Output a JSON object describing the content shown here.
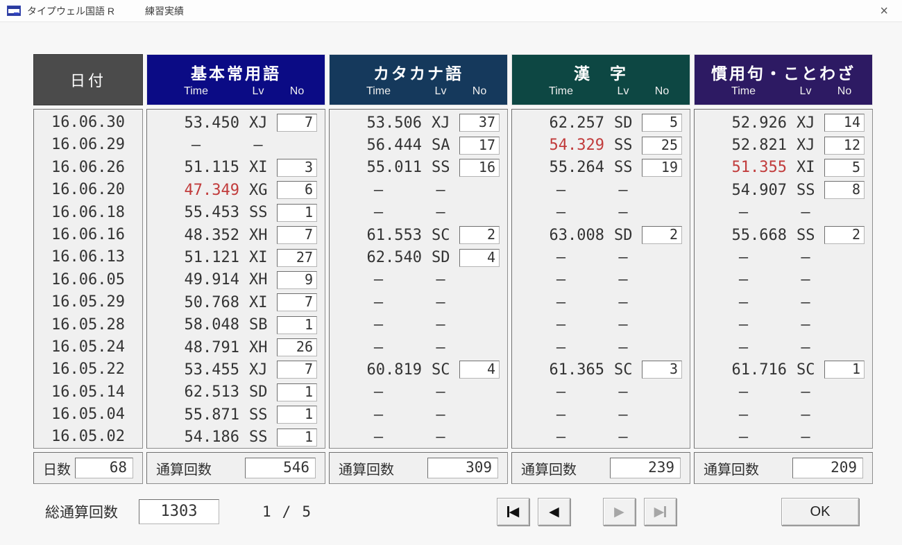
{
  "window": {
    "title": "タイプウェル国語 R",
    "subtitle": "練習実績",
    "close_glyph": "×"
  },
  "colors": {
    "record_time": "#c13b3b",
    "date_header_bg": "#4b4b4b",
    "category_header_bgs": [
      "#0b0b85",
      "#15395c",
      "#0d4743",
      "#2d1a63"
    ]
  },
  "table": {
    "date_header": "日付",
    "sub_headers": {
      "time": "Time",
      "lv": "Lv",
      "no": "No"
    },
    "empty_glyph": "–",
    "categories": [
      {
        "label": "基本常用語"
      },
      {
        "label": "カタカナ語"
      },
      {
        "label": "漢　字"
      },
      {
        "label": "慣用句・ことわざ"
      }
    ],
    "rows": [
      {
        "date": "16.06.30",
        "cells": [
          {
            "time": "53.450",
            "lv": "XJ",
            "no": "7",
            "record": false
          },
          {
            "time": "53.506",
            "lv": "XJ",
            "no": "37",
            "record": false
          },
          {
            "time": "62.257",
            "lv": "SD",
            "no": "5",
            "record": false
          },
          {
            "time": "52.926",
            "lv": "XJ",
            "no": "14",
            "record": false
          }
        ]
      },
      {
        "date": "16.06.29",
        "cells": [
          {
            "time": "–",
            "lv": "–",
            "no": null,
            "record": false
          },
          {
            "time": "56.444",
            "lv": "SA",
            "no": "17",
            "record": false
          },
          {
            "time": "54.329",
            "lv": "SS",
            "no": "25",
            "record": true
          },
          {
            "time": "52.821",
            "lv": "XJ",
            "no": "12",
            "record": false
          }
        ]
      },
      {
        "date": "16.06.26",
        "cells": [
          {
            "time": "51.115",
            "lv": "XI",
            "no": "3",
            "record": false
          },
          {
            "time": "55.011",
            "lv": "SS",
            "no": "16",
            "record": false
          },
          {
            "time": "55.264",
            "lv": "SS",
            "no": "19",
            "record": false
          },
          {
            "time": "51.355",
            "lv": "XI",
            "no": "5",
            "record": true
          }
        ]
      },
      {
        "date": "16.06.20",
        "cells": [
          {
            "time": "47.349",
            "lv": "XG",
            "no": "6",
            "record": true
          },
          {
            "time": "–",
            "lv": "–",
            "no": null,
            "record": false
          },
          {
            "time": "–",
            "lv": "–",
            "no": null,
            "record": false
          },
          {
            "time": "54.907",
            "lv": "SS",
            "no": "8",
            "record": false
          }
        ]
      },
      {
        "date": "16.06.18",
        "cells": [
          {
            "time": "55.453",
            "lv": "SS",
            "no": "1",
            "record": false
          },
          {
            "time": "–",
            "lv": "–",
            "no": null,
            "record": false
          },
          {
            "time": "–",
            "lv": "–",
            "no": null,
            "record": false
          },
          {
            "time": "–",
            "lv": "–",
            "no": null,
            "record": false
          }
        ]
      },
      {
        "date": "16.06.16",
        "cells": [
          {
            "time": "48.352",
            "lv": "XH",
            "no": "7",
            "record": false
          },
          {
            "time": "61.553",
            "lv": "SC",
            "no": "2",
            "record": false
          },
          {
            "time": "63.008",
            "lv": "SD",
            "no": "2",
            "record": false
          },
          {
            "time": "55.668",
            "lv": "SS",
            "no": "2",
            "record": false
          }
        ]
      },
      {
        "date": "16.06.13",
        "cells": [
          {
            "time": "51.121",
            "lv": "XI",
            "no": "27",
            "record": false
          },
          {
            "time": "62.540",
            "lv": "SD",
            "no": "4",
            "record": false
          },
          {
            "time": "–",
            "lv": "–",
            "no": null,
            "record": false
          },
          {
            "time": "–",
            "lv": "–",
            "no": null,
            "record": false
          }
        ]
      },
      {
        "date": "16.06.05",
        "cells": [
          {
            "time": "49.914",
            "lv": "XH",
            "no": "9",
            "record": false
          },
          {
            "time": "–",
            "lv": "–",
            "no": null,
            "record": false
          },
          {
            "time": "–",
            "lv": "–",
            "no": null,
            "record": false
          },
          {
            "time": "–",
            "lv": "–",
            "no": null,
            "record": false
          }
        ]
      },
      {
        "date": "16.05.29",
        "cells": [
          {
            "time": "50.768",
            "lv": "XI",
            "no": "7",
            "record": false
          },
          {
            "time": "–",
            "lv": "–",
            "no": null,
            "record": false
          },
          {
            "time": "–",
            "lv": "–",
            "no": null,
            "record": false
          },
          {
            "time": "–",
            "lv": "–",
            "no": null,
            "record": false
          }
        ]
      },
      {
        "date": "16.05.28",
        "cells": [
          {
            "time": "58.048",
            "lv": "SB",
            "no": "1",
            "record": false
          },
          {
            "time": "–",
            "lv": "–",
            "no": null,
            "record": false
          },
          {
            "time": "–",
            "lv": "–",
            "no": null,
            "record": false
          },
          {
            "time": "–",
            "lv": "–",
            "no": null,
            "record": false
          }
        ]
      },
      {
        "date": "16.05.24",
        "cells": [
          {
            "time": "48.791",
            "lv": "XH",
            "no": "26",
            "record": false
          },
          {
            "time": "–",
            "lv": "–",
            "no": null,
            "record": false
          },
          {
            "time": "–",
            "lv": "–",
            "no": null,
            "record": false
          },
          {
            "time": "–",
            "lv": "–",
            "no": null,
            "record": false
          }
        ]
      },
      {
        "date": "16.05.22",
        "cells": [
          {
            "time": "53.455",
            "lv": "XJ",
            "no": "7",
            "record": false
          },
          {
            "time": "60.819",
            "lv": "SC",
            "no": "4",
            "record": false
          },
          {
            "time": "61.365",
            "lv": "SC",
            "no": "3",
            "record": false
          },
          {
            "time": "61.716",
            "lv": "SC",
            "no": "1",
            "record": false
          }
        ]
      },
      {
        "date": "16.05.14",
        "cells": [
          {
            "time": "62.513",
            "lv": "SD",
            "no": "1",
            "record": false
          },
          {
            "time": "–",
            "lv": "–",
            "no": null,
            "record": false
          },
          {
            "time": "–",
            "lv": "–",
            "no": null,
            "record": false
          },
          {
            "time": "–",
            "lv": "–",
            "no": null,
            "record": false
          }
        ]
      },
      {
        "date": "16.05.04",
        "cells": [
          {
            "time": "55.871",
            "lv": "SS",
            "no": "1",
            "record": false
          },
          {
            "time": "–",
            "lv": "–",
            "no": null,
            "record": false
          },
          {
            "time": "–",
            "lv": "–",
            "no": null,
            "record": false
          },
          {
            "time": "–",
            "lv": "–",
            "no": null,
            "record": false
          }
        ]
      },
      {
        "date": "16.05.02",
        "cells": [
          {
            "time": "54.186",
            "lv": "SS",
            "no": "1",
            "record": false
          },
          {
            "time": "–",
            "lv": "–",
            "no": null,
            "record": false
          },
          {
            "time": "–",
            "lv": "–",
            "no": null,
            "record": false
          },
          {
            "time": "–",
            "lv": "–",
            "no": null,
            "record": false
          }
        ]
      }
    ]
  },
  "totals": {
    "days_label": "日数",
    "days_value": "68",
    "cumulative_label": "通算回数",
    "cumulative_values": [
      "546",
      "309",
      "239",
      "209"
    ]
  },
  "footer": {
    "grand_total_label": "総通算回数",
    "grand_total_value": "1303",
    "page_current": "1",
    "page_separator": "/",
    "page_total": "5",
    "nav": [
      {
        "id": "first",
        "enabled": true
      },
      {
        "id": "prev",
        "enabled": true
      },
      {
        "id": "next",
        "enabled": false
      },
      {
        "id": "last",
        "enabled": false
      }
    ],
    "ok_label": "OK"
  }
}
